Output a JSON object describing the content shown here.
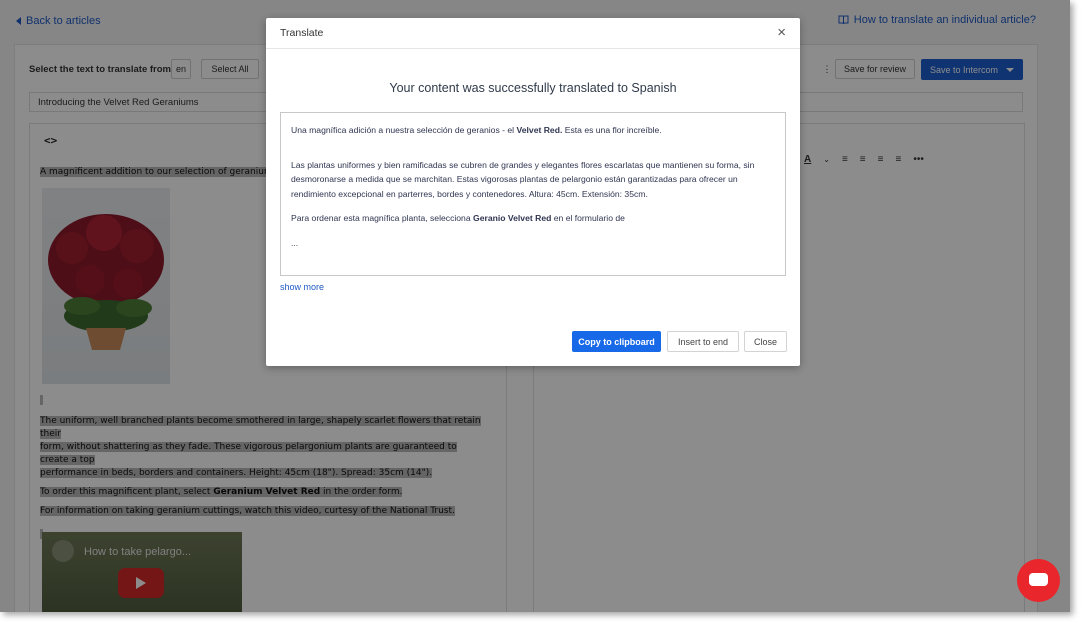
{
  "topbar": {
    "back_label": "Back to articles",
    "help_link": "How to translate an individual article?"
  },
  "toolbar": {
    "select_label": "Select the text to translate from",
    "lang": "en",
    "select_all": "Select All",
    "save_review": "Save for review",
    "save_intercom": "Save to Intercom"
  },
  "article": {
    "title": "Introducing the Velvet Red Geraniums",
    "source_code_toggle": "<>",
    "lines": {
      "intro": "A magnificent addition to our selection of geraniums - t",
      "uniform_1": "The uniform, well branched plants become smothered in large, shapely scarlet flowers that retain their",
      "uniform_2": "form, without shattering as they fade. These vigorous pelargonium plants are guaranteed to create a top",
      "uniform_3": "performance in beds, borders and containers. Height: 45cm (18\"). Spread: 35cm (14\").",
      "order_pre": "To order this magnificent plant, select ",
      "order_bold": "Geranium Velvet Red",
      "order_post": " in the order form.",
      "info": "For information on taking geranium cuttings, watch this video, curtesy of the National Trust."
    },
    "video_title": "How to take pelargo..."
  },
  "modal": {
    "title": "Translate",
    "close_glyph": "×",
    "heading": "Your content was successfully translated to Spanish",
    "p1_pre": "Una magnífica adición a nuestra selección de geranios - el ",
    "p1_bold": "Velvet Red.",
    "p1_post": " Esta es una flor increíble.",
    "p2": "Las plantas uniformes y bien ramificadas se cubren de grandes y elegantes flores escarlatas que mantienen su forma, sin desmoronarse a medida que se marchitan. Estas vigorosas plantas de pelargonio están garantizadas para ofrecer un rendimiento excepcional en parterres, bordes y contenedores. Altura: 45cm. Extensión: 35cm.",
    "p3_pre": "Para ordenar esta magnífica planta, selecciona ",
    "p3_bold": "Geranio Velvet Red",
    "p3_post": " en el formulario de",
    "ellipsis": "...",
    "show_more": "show more",
    "copy_btn": "Copy to clipboard",
    "insert_btn": "Insert to end",
    "close_btn": "Close"
  },
  "colors": {
    "accent": "#1e5fcf",
    "primary_button": "#1769e8",
    "fab": "#e8262b"
  }
}
